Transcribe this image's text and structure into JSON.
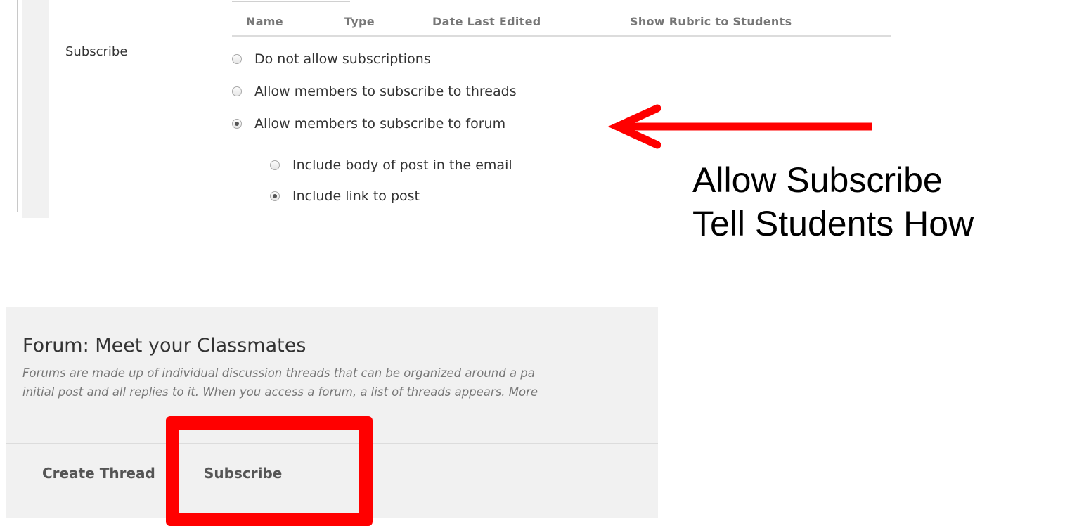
{
  "settings": {
    "table_headers": [
      "Name",
      "Type",
      "Date Last Edited",
      "Show Rubric to Students"
    ],
    "subscribe_label": "Subscribe",
    "options": [
      {
        "label": "Do not allow subscriptions",
        "checked": false
      },
      {
        "label": "Allow members to subscribe to threads",
        "checked": false
      },
      {
        "label": "Allow members to subscribe to forum",
        "checked": true
      }
    ],
    "sub_options": [
      {
        "label": "Include body of post in the email",
        "checked": false
      },
      {
        "label": "Include link to post",
        "checked": true
      }
    ]
  },
  "annotation": {
    "line1": "Allow Subscribe",
    "line2": "Tell Students How",
    "color": "#ff0000"
  },
  "forum": {
    "title": "Forum: Meet your Classmates",
    "description_line1": "Forums are made up of individual discussion threads that can be organized around a pa",
    "description_line2": "initial post and all replies to it. When you access a forum, a list of threads appears. ",
    "more_link": "More",
    "actions": {
      "create_thread": "Create Thread",
      "subscribe": "Subscribe"
    }
  }
}
